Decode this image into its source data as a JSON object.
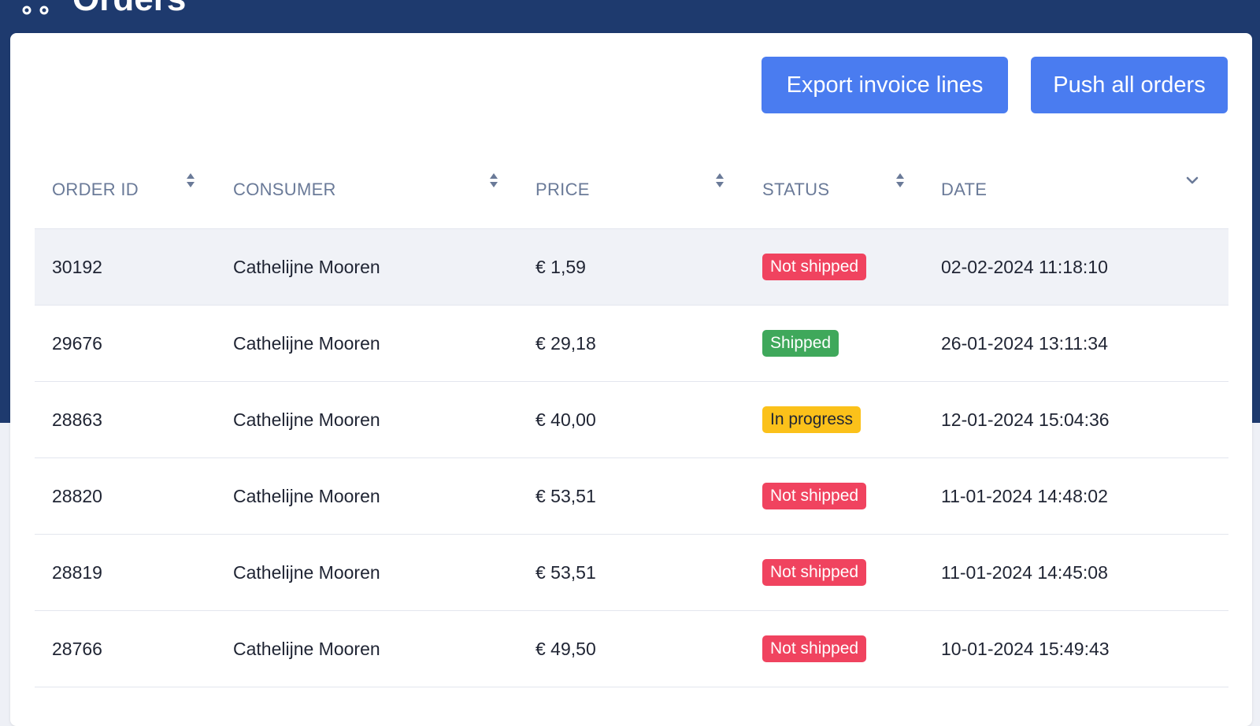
{
  "header": {
    "title": "Orders"
  },
  "toolbar": {
    "export_label": "Export invoice lines",
    "push_label": "Push all orders"
  },
  "table": {
    "columns": [
      {
        "label": "ORDER ID",
        "sort": "both"
      },
      {
        "label": "CONSUMER",
        "sort": "both"
      },
      {
        "label": "PRICE",
        "sort": "both"
      },
      {
        "label": "STATUS",
        "sort": "both"
      },
      {
        "label": "DATE",
        "sort": "descending"
      }
    ],
    "rows": [
      {
        "id": "30192",
        "consumer": "Cathelijne Mooren",
        "price": "€ 1,59",
        "status": "Not shipped",
        "status_color": "#f0435f",
        "date": "02-02-2024 11:18:10"
      },
      {
        "id": "29676",
        "consumer": "Cathelijne Mooren",
        "price": "€ 29,18",
        "status": "Shipped",
        "status_color": "#3fa85b",
        "date": "26-01-2024 13:11:34"
      },
      {
        "id": "28863",
        "consumer": "Cathelijne Mooren",
        "price": "€ 40,00",
        "status": "In progress",
        "status_color": "#fbc11a",
        "date": "12-01-2024 15:04:36"
      },
      {
        "id": "28820",
        "consumer": "Cathelijne Mooren",
        "price": "€ 53,51",
        "status": "Not shipped",
        "status_color": "#f0435f",
        "date": "11-01-2024 14:48:02"
      },
      {
        "id": "28819",
        "consumer": "Cathelijne Mooren",
        "price": "€ 53,51",
        "status": "Not shipped",
        "status_color": "#f0435f",
        "date": "11-01-2024 14:45:08"
      },
      {
        "id": "28766",
        "consumer": "Cathelijne Mooren",
        "price": "€ 49,50",
        "status": "Not shipped",
        "status_color": "#f0435f",
        "date": "10-01-2024 15:49:43"
      }
    ]
  },
  "colors": {
    "header_bg": "#1e3a6e",
    "accent": "#4a7cf0",
    "page_bg": "#eef0f6"
  }
}
